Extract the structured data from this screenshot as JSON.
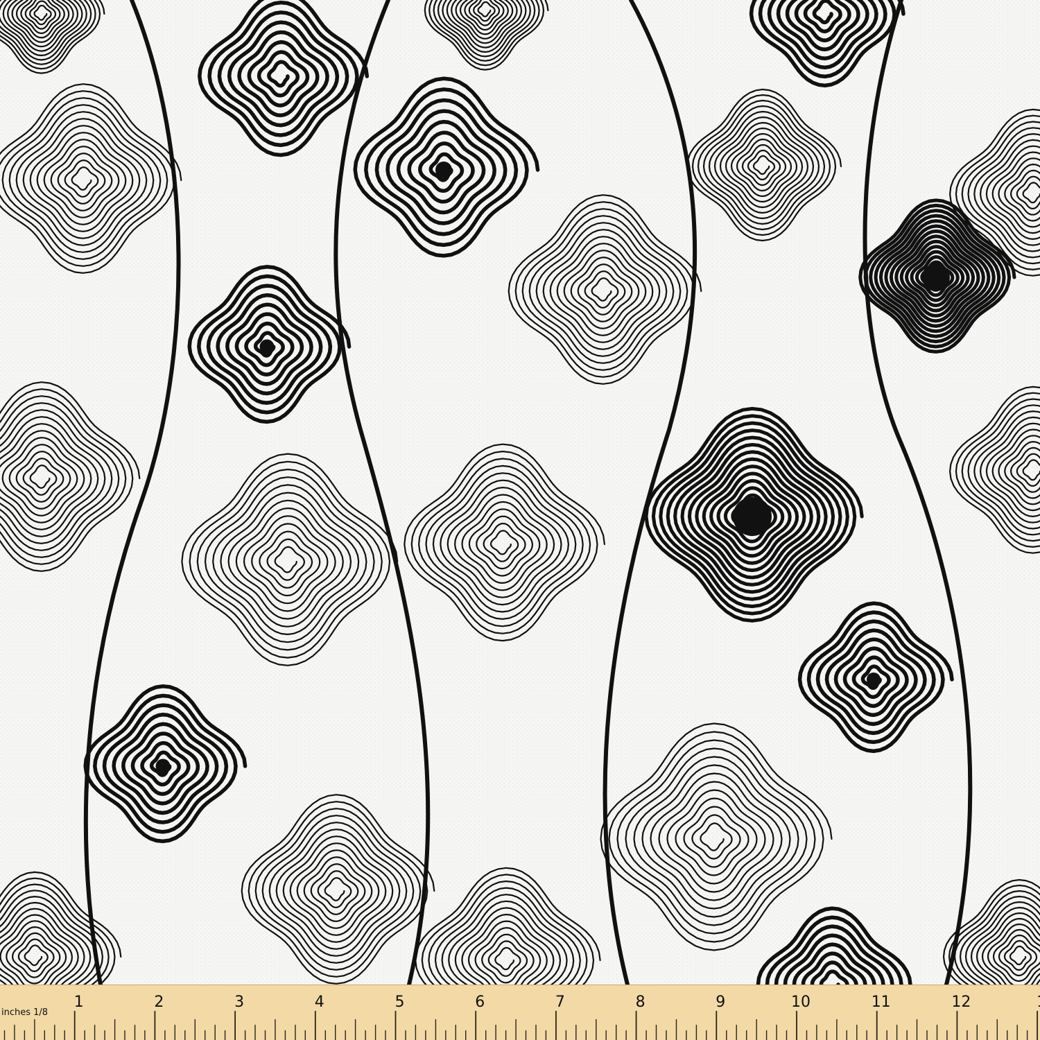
{
  "fabric": {
    "background": "#f6f6f4",
    "ink": "#111111"
  },
  "ruler": {
    "background": "#f2d9a6",
    "tick_color": "#2a2418",
    "unit_label": "inches 1/8",
    "numbers": [
      "1",
      "2",
      "3",
      "4",
      "5",
      "6",
      "7",
      "8",
      "9",
      "10",
      "11",
      "12",
      "1"
    ]
  }
}
